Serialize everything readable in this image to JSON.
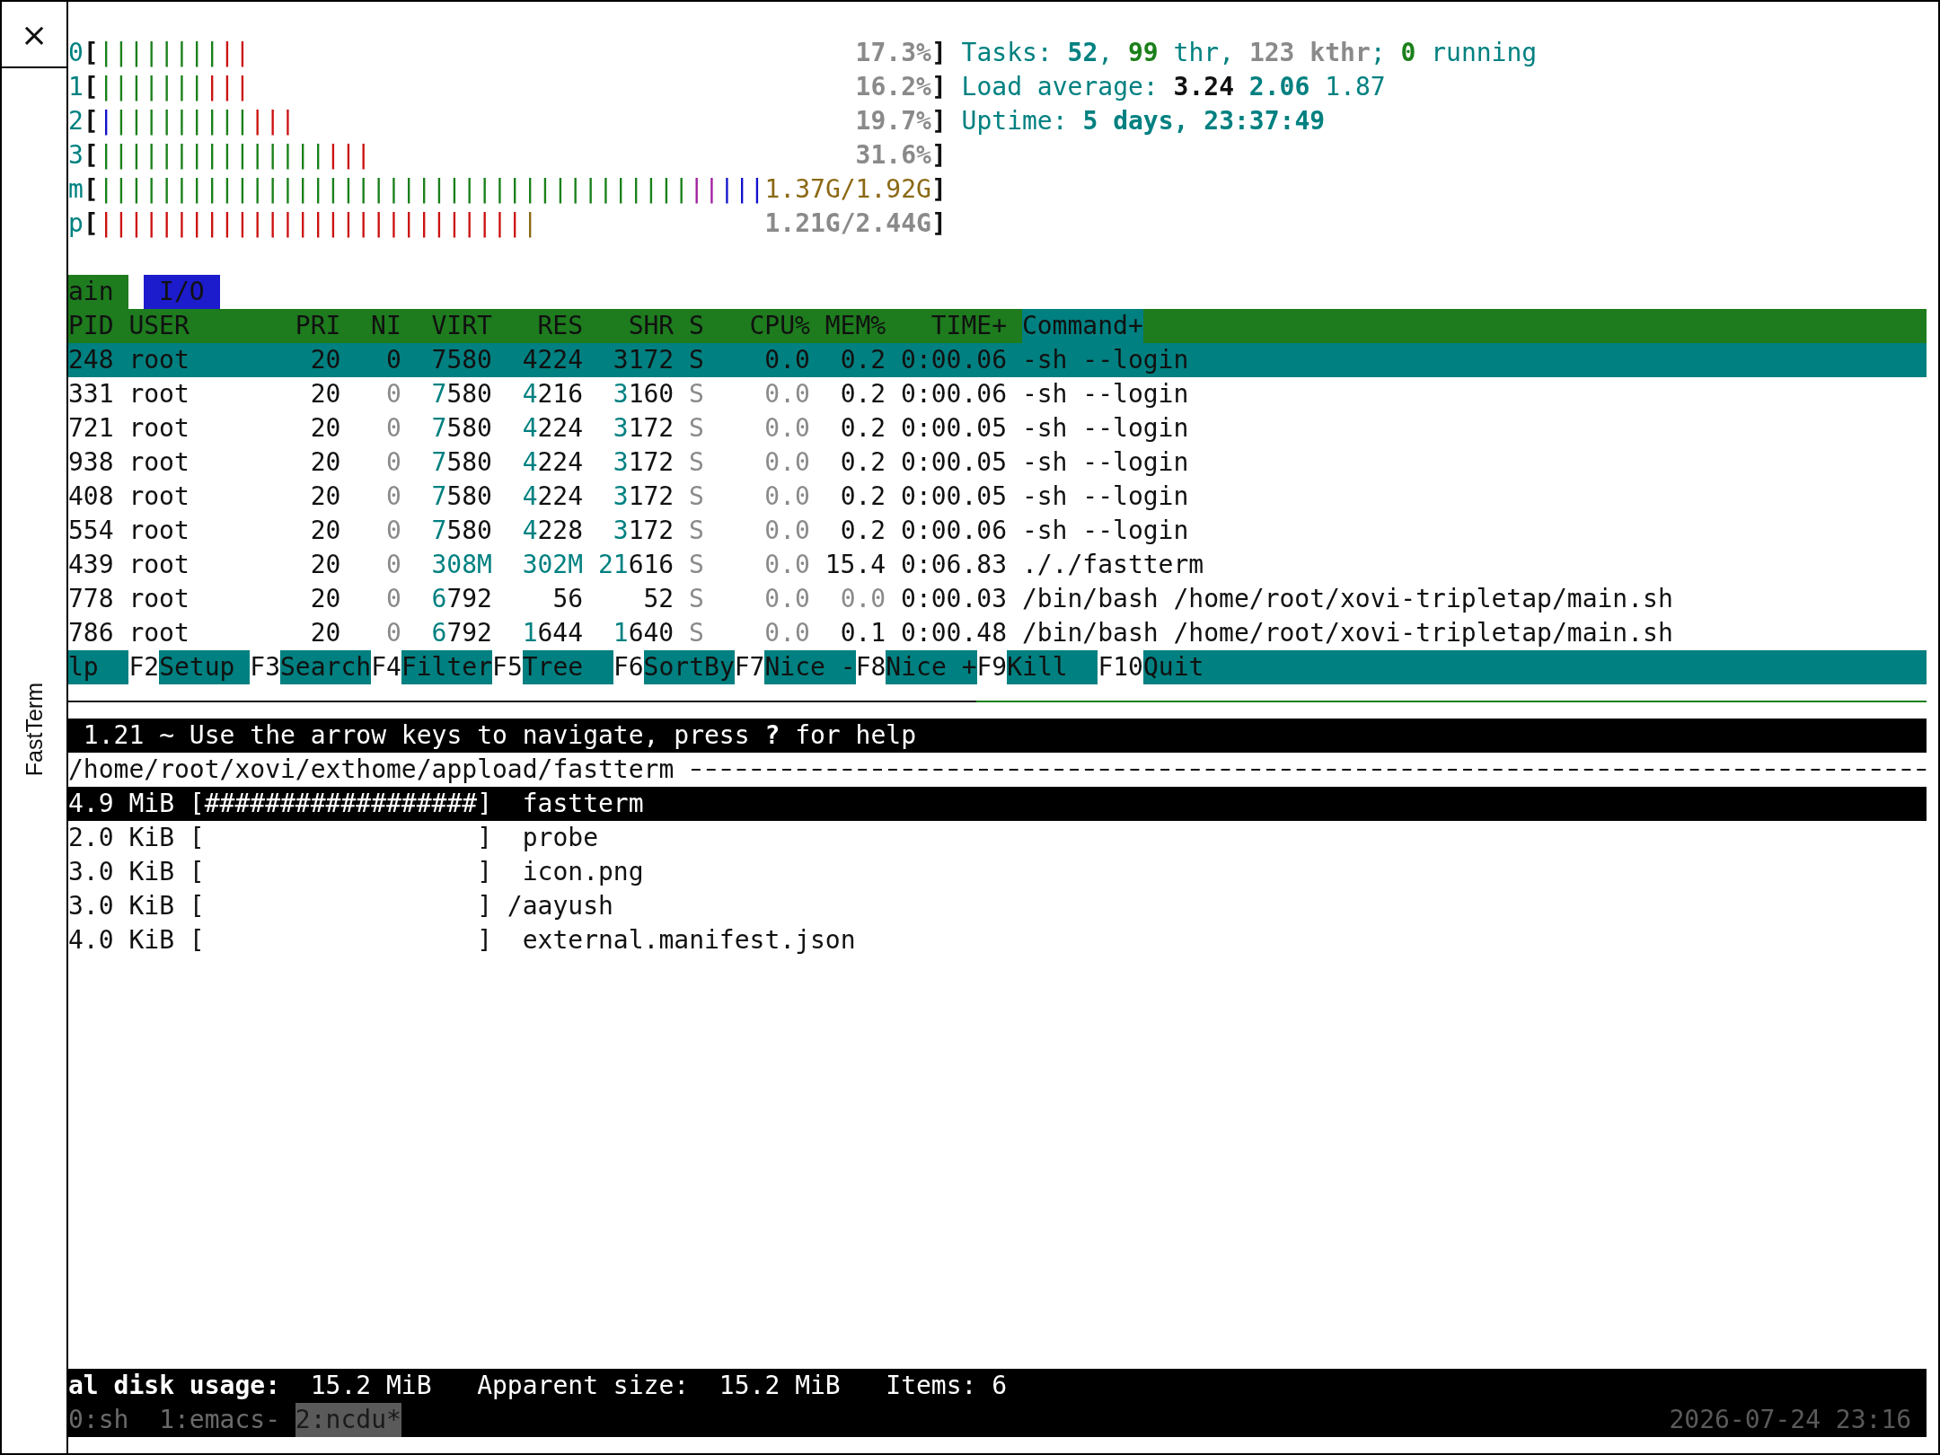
{
  "side_panel": {
    "close": "×",
    "title": "FastTerm"
  },
  "meters": [
    {
      "kind": "cpu",
      "label": "0",
      "open": "[",
      "segments": [
        {
          "color": "#1a801a",
          "text": "||||||||"
        },
        {
          "color": "#cc1111",
          "text": "||"
        }
      ],
      "value": "17.3%",
      "close": "]"
    },
    {
      "kind": "cpu",
      "label": "1",
      "open": "[",
      "segments": [
        {
          "color": "#1a801a",
          "text": "|||||||"
        },
        {
          "color": "#cc1111",
          "text": "|||"
        }
      ],
      "value": "16.2%",
      "close": "]"
    },
    {
      "kind": "cpu",
      "label": "2",
      "open": "[",
      "segments": [
        {
          "color": "#1111cc",
          "text": "|"
        },
        {
          "color": "#1a801a",
          "text": "|||||||||"
        },
        {
          "color": "#cc1111",
          "text": "|||"
        }
      ],
      "value": "19.7%",
      "close": "]"
    },
    {
      "kind": "cpu",
      "label": "3",
      "open": "[",
      "segments": [
        {
          "color": "#1a801a",
          "text": "|||||||||||||||"
        },
        {
          "color": "#cc1111",
          "text": "|||"
        }
      ],
      "value": "31.6%",
      "close": "]"
    },
    {
      "kind": "memory",
      "label": "m",
      "open": "[",
      "segments": [
        {
          "color": "#1a801a",
          "text": "|||||||||||||||||||||||||||||||||||||||"
        },
        {
          "color": "#a020a0",
          "text": "||"
        },
        {
          "color": "#1111cc",
          "text": "|||"
        }
      ],
      "value": "1.37G/1.92G",
      "close": "]"
    },
    {
      "kind": "swap",
      "label": "p",
      "open": "[",
      "segments": [
        {
          "color": "#cc1111",
          "text": "||||||||||||||||||||||||||||"
        },
        {
          "color": "#8b6914",
          "text": "|"
        }
      ],
      "value": "1.21G/2.44G",
      "close": "]"
    }
  ],
  "info": [
    {
      "parts": [
        {
          "text": "Tasks: ",
          "kind": "label"
        },
        {
          "text": "52",
          "kind": "value"
        },
        {
          "text": ", ",
          "kind": "label"
        },
        {
          "text": "99",
          "kind": "good"
        },
        {
          "text": " thr, ",
          "kind": "label"
        },
        {
          "text": "123 kthr",
          "kind": "muted"
        },
        {
          "text": "; ",
          "kind": "label"
        },
        {
          "text": "0",
          "kind": "good"
        },
        {
          "text": " running",
          "kind": "label"
        }
      ]
    },
    {
      "parts": [
        {
          "text": "Load average: ",
          "kind": "label"
        },
        {
          "text": "3.24",
          "kind": "strong"
        },
        {
          "text": " 2.06",
          "kind": "value"
        },
        {
          "text": " 1.87",
          "kind": "label"
        }
      ]
    },
    {
      "parts": [
        {
          "text": "Uptime: ",
          "kind": "label"
        },
        {
          "text": "5 days, 23:37:49",
          "kind": "value"
        }
      ]
    }
  ],
  "tabs": [
    {
      "label": "ain",
      "selected": true
    },
    {
      "label": "I/O",
      "selected": false
    }
  ],
  "columns": [
    {
      "label": "PID",
      "selected": false
    },
    {
      "label": "USER",
      "selected": false
    },
    {
      "label": "PRI",
      "selected": false
    },
    {
      "label": "NI",
      "selected": false
    },
    {
      "label": "VIRT",
      "selected": false
    },
    {
      "label": "RES",
      "selected": false
    },
    {
      "label": "SHR",
      "selected": false
    },
    {
      "label": "S",
      "selected": false
    },
    {
      "label": "CPU%",
      "selected": false
    },
    {
      "label": "MEM%",
      "selected": false
    },
    {
      "label": "TIME+",
      "selected": false
    },
    {
      "label": "Command+",
      "selected": true
    }
  ],
  "processes": [
    {
      "selected": true,
      "pid": "248",
      "user": "root",
      "pri": "20",
      "ni": "0",
      "virt": {
        "hi": "7",
        "lo": "580"
      },
      "res": {
        "hi": "4",
        "lo": "224"
      },
      "shr": {
        "hi": "3",
        "lo": "172"
      },
      "state": "S",
      "cpu": "0.0",
      "mem": {
        "text": "0.2",
        "dim": false
      },
      "time": "0:00.06",
      "command": "-sh --login"
    },
    {
      "selected": false,
      "pid": "331",
      "user": "root",
      "pri": "20",
      "ni": "0",
      "virt": {
        "hi": "7",
        "lo": "580"
      },
      "res": {
        "hi": "4",
        "lo": "216"
      },
      "shr": {
        "hi": "3",
        "lo": "160"
      },
      "state": "S",
      "cpu": "0.0",
      "mem": {
        "text": "0.2",
        "dim": false
      },
      "time": "0:00.06",
      "command": "-sh --login"
    },
    {
      "selected": false,
      "pid": "721",
      "user": "root",
      "pri": "20",
      "ni": "0",
      "virt": {
        "hi": "7",
        "lo": "580"
      },
      "res": {
        "hi": "4",
        "lo": "224"
      },
      "shr": {
        "hi": "3",
        "lo": "172"
      },
      "state": "S",
      "cpu": "0.0",
      "mem": {
        "text": "0.2",
        "dim": false
      },
      "time": "0:00.05",
      "command": "-sh --login"
    },
    {
      "selected": false,
      "pid": "938",
      "user": "root",
      "pri": "20",
      "ni": "0",
      "virt": {
        "hi": "7",
        "lo": "580"
      },
      "res": {
        "hi": "4",
        "lo": "224"
      },
      "shr": {
        "hi": "3",
        "lo": "172"
      },
      "state": "S",
      "cpu": "0.0",
      "mem": {
        "text": "0.2",
        "dim": false
      },
      "time": "0:00.05",
      "command": "-sh --login"
    },
    {
      "selected": false,
      "pid": "408",
      "user": "root",
      "pri": "20",
      "ni": "0",
      "virt": {
        "hi": "7",
        "lo": "580"
      },
      "res": {
        "hi": "4",
        "lo": "224"
      },
      "shr": {
        "hi": "3",
        "lo": "172"
      },
      "state": "S",
      "cpu": "0.0",
      "mem": {
        "text": "0.2",
        "dim": false
      },
      "time": "0:00.05",
      "command": "-sh --login"
    },
    {
      "selected": false,
      "pid": "554",
      "user": "root",
      "pri": "20",
      "ni": "0",
      "virt": {
        "hi": "7",
        "lo": "580"
      },
      "res": {
        "hi": "4",
        "lo": "228"
      },
      "shr": {
        "hi": "3",
        "lo": "172"
      },
      "state": "S",
      "cpu": "0.0",
      "mem": {
        "text": "0.2",
        "dim": false
      },
      "time": "0:00.06",
      "command": "-sh --login"
    },
    {
      "selected": false,
      "pid": "439",
      "user": "root",
      "pri": "20",
      "ni": "0",
      "virt": {
        "hi": "308M"
      },
      "res": {
        "hi": "302M"
      },
      "shr": {
        "hi": "21",
        "lo": "616"
      },
      "state": "S",
      "cpu": "0.0",
      "mem": {
        "text": "15.4",
        "dim": false
      },
      "time": "0:06.83",
      "command": "././fastterm"
    },
    {
      "selected": false,
      "pid": "778",
      "user": "root",
      "pri": "20",
      "ni": "0",
      "virt": {
        "hi": "6",
        "lo": "792"
      },
      "res": {
        "lo": "56"
      },
      "shr": {
        "lo": "52"
      },
      "state": "S",
      "cpu": "0.0",
      "mem": {
        "text": "0.0",
        "dim": true
      },
      "time": "0:00.03",
      "command": "/bin/bash /home/root/xovi-tripletap/main.sh"
    },
    {
      "selected": false,
      "pid": "786",
      "user": "root",
      "pri": "20",
      "ni": "0",
      "virt": {
        "hi": "6",
        "lo": "792"
      },
      "res": {
        "hi": "1",
        "lo": "644"
      },
      "shr": {
        "hi": "1",
        "lo": "640"
      },
      "state": "S",
      "cpu": "0.0",
      "mem": {
        "text": "0.1",
        "dim": false
      },
      "time": "0:00.48",
      "command": "/bin/bash /home/root/xovi-tripletap/main.sh"
    }
  ],
  "function_keys": [
    {
      "label": "lp"
    },
    {
      "key": "F2",
      "label": "Setup"
    },
    {
      "key": "F3",
      "label": "Search"
    },
    {
      "key": "F4",
      "label": "Filter"
    },
    {
      "key": "F5",
      "label": "Tree"
    },
    {
      "key": "F6",
      "label": "SortBy"
    },
    {
      "key": "F7",
      "label": "Nice -"
    },
    {
      "key": "F8",
      "label": "Nice +"
    },
    {
      "key": "F9",
      "label": "Kill"
    },
    {
      "key": "F10",
      "label": "Quit"
    }
  ],
  "ncdu": {
    "header": "1.21 ~ Use the arrow keys to navigate, press **?** for help",
    "path": "/home/root/xovi/exthome/appload/fastterm",
    "items": [
      {
        "kind": "file",
        "selected": true,
        "size": "4.9 MiB",
        "graph": "[##################]",
        "name": "fastterm"
      },
      {
        "kind": "file",
        "selected": false,
        "size": "2.0 KiB",
        "graph": "[                  ]",
        "name": "probe"
      },
      {
        "kind": "file",
        "selected": false,
        "size": "3.0 KiB",
        "graph": "[                  ]",
        "name": "icon.png"
      },
      {
        "kind": "dir",
        "selected": false,
        "size": "3.0 KiB",
        "graph": "[                  ]",
        "name": "/aayush"
      },
      {
        "kind": "file",
        "selected": false,
        "size": "4.0 KiB",
        "graph": "[                  ]",
        "name": "external.manifest.json"
      }
    ],
    "status": {
      "disk_label": "al disk usage:",
      "disk_value": "15.2 MiB",
      "apparent_label": "Apparent size:",
      "apparent_value": "15.2 MiB",
      "items": "Items: 6"
    }
  },
  "tmux": {
    "windows": [
      {
        "label": "0:sh",
        "selected": false
      },
      {
        "label": "1:emacs-",
        "selected": false
      },
      {
        "label": "2:ncdu*",
        "selected": true
      }
    ],
    "clock": "2026-07-24 23:16"
  }
}
